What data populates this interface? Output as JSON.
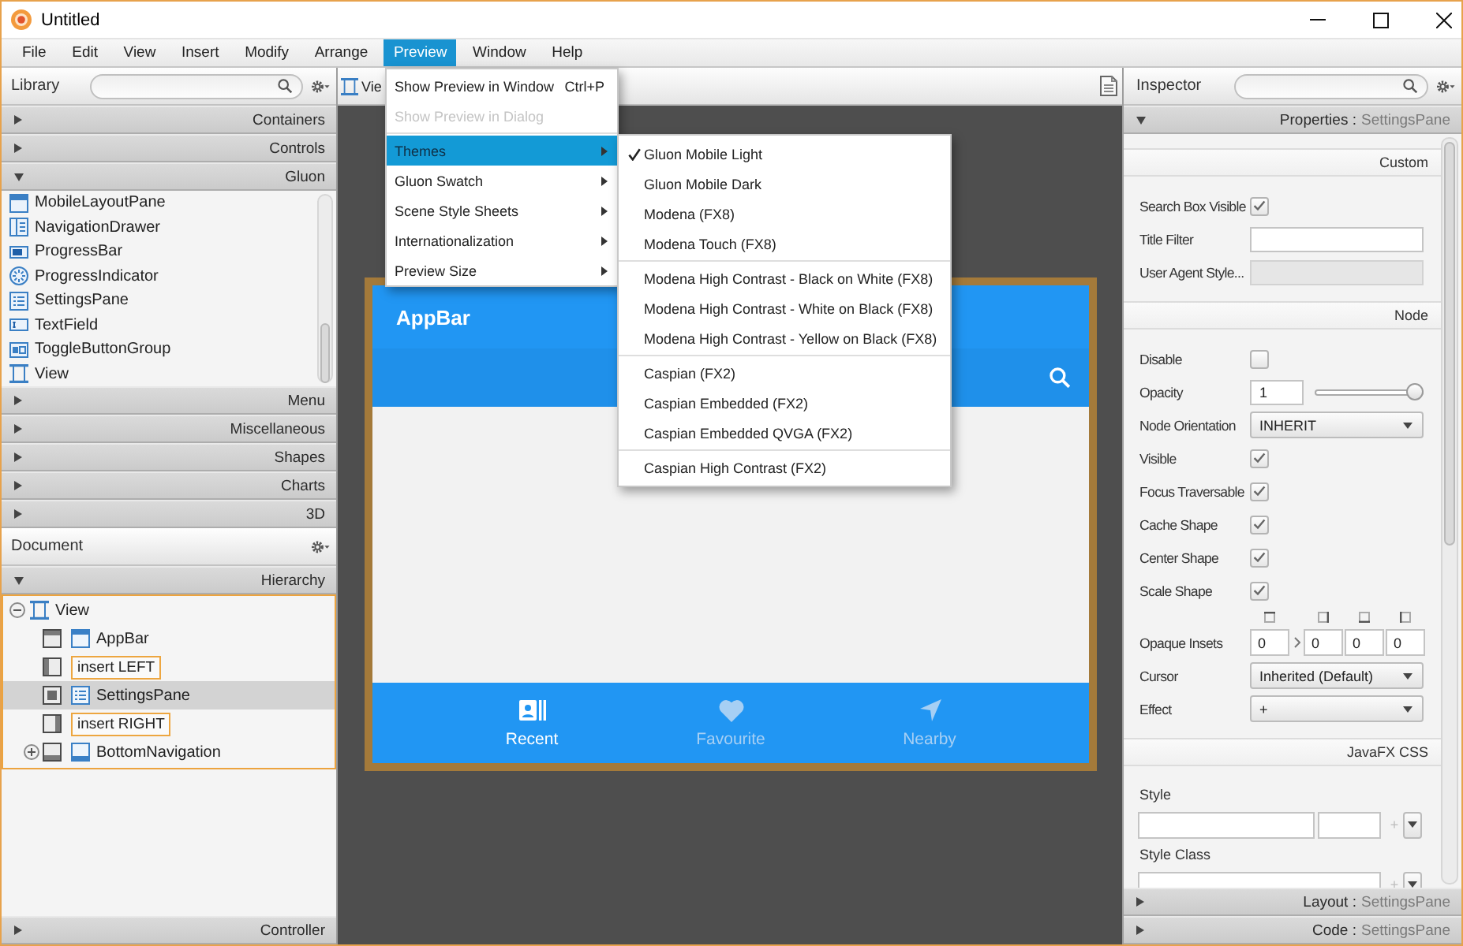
{
  "window": {
    "title": "Untitled"
  },
  "menu_bar": [
    {
      "label": "File",
      "selected": false
    },
    {
      "label": "Edit",
      "selected": false
    },
    {
      "label": "View",
      "selected": false
    },
    {
      "label": "Insert",
      "selected": false
    },
    {
      "label": "Modify",
      "selected": false
    },
    {
      "label": "Arrange",
      "selected": false
    },
    {
      "label": "Preview",
      "selected": true
    },
    {
      "label": "Window",
      "selected": false
    },
    {
      "label": "Help",
      "selected": false
    }
  ],
  "preview_menu": [
    {
      "kind": "item",
      "label": "Show Preview in Window",
      "shortcut": "Ctrl+P",
      "selected": false,
      "disabled": false,
      "submenu": false
    },
    {
      "kind": "item",
      "label": "Show Preview in Dialog",
      "selected": false,
      "disabled": true,
      "submenu": false
    },
    {
      "kind": "separator"
    },
    {
      "kind": "item",
      "label": "Themes",
      "selected": true,
      "disabled": false,
      "submenu": true
    },
    {
      "kind": "item",
      "label": "Gluon Swatch",
      "selected": false,
      "disabled": false,
      "submenu": true
    },
    {
      "kind": "item",
      "label": "Scene Style Sheets",
      "selected": false,
      "disabled": false,
      "submenu": true
    },
    {
      "kind": "item",
      "label": "Internationalization",
      "selected": false,
      "disabled": false,
      "submenu": true
    },
    {
      "kind": "item",
      "label": "Preview Size",
      "selected": false,
      "disabled": false,
      "submenu": true
    }
  ],
  "themes_submenu": [
    {
      "kind": "item",
      "label": "Gluon Mobile Light",
      "checked": true
    },
    {
      "kind": "item",
      "label": "Gluon Mobile Dark",
      "checked": false
    },
    {
      "kind": "item",
      "label": "Modena (FX8)",
      "checked": false
    },
    {
      "kind": "item",
      "label": "Modena Touch (FX8)",
      "checked": false
    },
    {
      "kind": "separator"
    },
    {
      "kind": "item",
      "label": "Modena High Contrast - Black on White (FX8)",
      "checked": false
    },
    {
      "kind": "item",
      "label": "Modena High Contrast - White on Black (FX8)",
      "checked": false
    },
    {
      "kind": "item",
      "label": "Modena High Contrast - Yellow on Black (FX8)",
      "checked": false
    },
    {
      "kind": "separator"
    },
    {
      "kind": "item",
      "label": "Caspian (FX2)",
      "checked": false
    },
    {
      "kind": "item",
      "label": "Caspian Embedded (FX2)",
      "checked": false
    },
    {
      "kind": "item",
      "label": "Caspian Embedded QVGA (FX2)",
      "checked": false
    },
    {
      "kind": "separator"
    },
    {
      "kind": "item",
      "label": "Caspian High Contrast (FX2)",
      "checked": false
    }
  ],
  "library": {
    "title": "Library",
    "sections": [
      {
        "label": "Containers",
        "expanded": false
      },
      {
        "label": "Controls",
        "expanded": false
      },
      {
        "label": "Gluon",
        "expanded": true,
        "items": [
          "MobileLayoutPane",
          "NavigationDrawer",
          "ProgressBar",
          "ProgressIndicator",
          "SettingsPane",
          "TextField",
          "ToggleButtonGroup",
          "View"
        ]
      },
      {
        "label": "Menu",
        "expanded": false
      },
      {
        "label": "Miscellaneous",
        "expanded": false
      },
      {
        "label": "Shapes",
        "expanded": false
      },
      {
        "label": "Charts",
        "expanded": false
      },
      {
        "label": "3D",
        "expanded": false
      }
    ]
  },
  "document": {
    "title": "Document",
    "hierarchy": {
      "label": "Hierarchy",
      "expanded": true,
      "tree": [
        {
          "kind": "node",
          "label": "View",
          "expanded": true,
          "selected": false,
          "children": [
            {
              "kind": "node",
              "label": "AppBar",
              "selected": false
            },
            {
              "kind": "slot",
              "label": "insert LEFT",
              "selected": false
            },
            {
              "kind": "node",
              "label": "SettingsPane",
              "selected": true
            },
            {
              "kind": "slot",
              "label": "insert RIGHT",
              "selected": false
            },
            {
              "kind": "node",
              "label": "BottomNavigation",
              "expanded": false,
              "selected": false
            }
          ]
        }
      ]
    },
    "controller": {
      "label": "Controller",
      "expanded": false
    }
  },
  "editor": {
    "breadcrumb": "Vie",
    "preview": {
      "app_bar": {
        "title": "AppBar"
      },
      "bottom_navigation": [
        {
          "label": "Recent",
          "selected": true
        },
        {
          "label": "Favourite",
          "selected": false
        },
        {
          "label": "Nearby",
          "selected": false
        }
      ]
    }
  },
  "inspector": {
    "title": "Inspector",
    "properties": {
      "label": "Properties :",
      "target": "SettingsPane",
      "expanded": true
    },
    "sections": [
      {
        "title": "Custom",
        "rows": [
          {
            "kind": "checkbox",
            "label": "Search Box Visible",
            "checked": true
          },
          {
            "kind": "text",
            "label": "Title Filter",
            "disabled": false
          },
          {
            "kind": "text",
            "label": "User Agent Style...",
            "disabled": true
          }
        ]
      },
      {
        "title": "Node",
        "rows": [
          {
            "kind": "checkbox",
            "label": "Disable",
            "checked": false
          },
          {
            "kind": "slider",
            "label": "Opacity",
            "value": "1",
            "level": 1
          },
          {
            "kind": "combo",
            "label": "Node Orientation",
            "value": "INHERIT"
          },
          {
            "kind": "checkbox",
            "label": "Visible",
            "checked": true
          },
          {
            "kind": "checkbox",
            "label": "Focus Traversable",
            "checked": true
          },
          {
            "kind": "checkbox",
            "label": "Cache Shape",
            "checked": true
          },
          {
            "kind": "checkbox",
            "label": "Center Shape",
            "checked": true
          },
          {
            "kind": "checkbox",
            "label": "Scale Shape",
            "checked": true
          },
          {
            "kind": "insets",
            "label": "Opaque Insets",
            "values": [
              "0",
              "0",
              "0",
              "0"
            ]
          },
          {
            "kind": "combo",
            "label": "Cursor",
            "value": "Inherited (Default)"
          },
          {
            "kind": "combo",
            "label": "Effect",
            "value": "+"
          }
        ]
      },
      {
        "title": "JavaFX CSS",
        "rows": [
          {
            "kind": "style",
            "label": "Style",
            "add": "+",
            "add_disabled": true
          },
          {
            "kind": "classlist",
            "label": "Style Class",
            "add": "+",
            "add_disabled": true
          }
        ]
      }
    ],
    "panels": [
      {
        "label": "Layout :",
        "target": "SettingsPane",
        "expanded": false
      },
      {
        "label": "Code :",
        "target": "SettingsPane",
        "expanded": false
      }
    ]
  }
}
